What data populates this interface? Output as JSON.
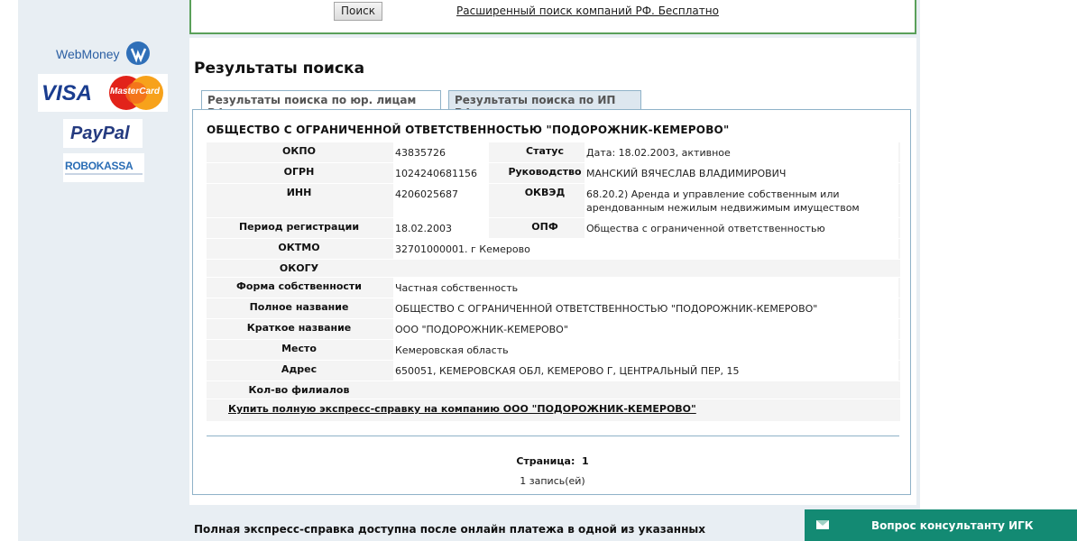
{
  "search": {
    "button_label": "Поиск",
    "advanced_link": "Расширенный поиск компаний РФ. Бесплатно"
  },
  "payments": {
    "webmoney": "WebMoney",
    "visa": "VISA",
    "mastercard": "MasterCard",
    "paypal": "PayPal",
    "robokassa": "ROBOKASSA"
  },
  "results": {
    "heading": "Результаты поиска",
    "tabs": [
      {
        "label": "Результаты поиска по юр. лицам РФ",
        "active": true
      },
      {
        "label": "Результаты поиска по ИП РФ",
        "active": false
      }
    ],
    "company_title": "ОБЩЕСТВО С ОГРАНИЧЕННОЙ ОТВЕТСТВЕННОСТЬЮ \"ПОДОРОЖНИК-КЕМЕРОВО\"",
    "fields": {
      "okpo_label": "ОКПО",
      "okpo_value": "43835726",
      "status_label": "Статус",
      "status_value": "Дата: 18.02.2003, активное",
      "ogrn_label": "ОГРН",
      "ogrn_value": "1024240681156",
      "mgmt_label": "Руководство",
      "mgmt_value": "МАНСКИЙ ВЯЧЕСЛАВ ВЛАДИМИРОВИЧ",
      "inn_label": "ИНН",
      "inn_value": "4206025687",
      "okved_label": "ОКВЭД",
      "okved_value": "68.20.2) Аренда и управление собственным или арендованным нежилым недвижимым имуществом",
      "reg_label": "Период регистрации",
      "reg_value": "18.02.2003",
      "opf_label": "ОПФ",
      "opf_value": "Общества с ограниченной ответственностью",
      "oktmo_label": "ОКТМО",
      "oktmo_value": "32701000001. г Кемерово",
      "okogu_label": "ОКОГУ",
      "ownership_label": "Форма собственности",
      "ownership_value": "Частная собственность",
      "fullname_label": "Полное название",
      "fullname_value": "ОБЩЕСТВО С ОГРАНИЧЕННОЙ ОТВЕТСТВЕННОСТЬЮ \"ПОДОРОЖНИК-КЕМЕРОВО\"",
      "shortname_label": "Краткое название",
      "shortname_value": "ООО \"ПОДОРОЖНИК-КЕМЕРОВО\"",
      "place_label": "Место",
      "place_value": "Кемеровская область",
      "address_label": "Адрес",
      "address_value": "650051, КЕМЕРОВСКАЯ ОБЛ, КЕМЕРОВО Г, ЦЕНТРАЛЬНЫЙ ПЕР, 15",
      "branches_label": "Кол-во филиалов"
    },
    "buy_link": "Купить полную экспресс-справку на компанию ООО \"ПОДОРОЖНИК-КЕМЕРОВО\"",
    "page_label": "Страница:",
    "page_number": "1",
    "records": "1 запись(ей)"
  },
  "footer_text": "Полная экспресс-справка доступна после онлайн платежа в одной из указанных",
  "consult": {
    "label": "Вопрос консультанту ИГК",
    "bg_color": "#138a73"
  }
}
